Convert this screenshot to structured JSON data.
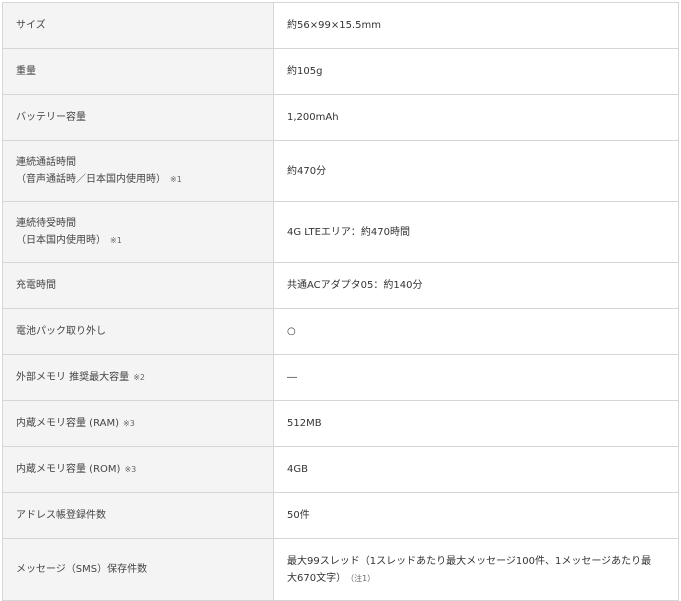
{
  "rows": [
    {
      "label": "サイズ",
      "value": "約56×99×15.5mm"
    },
    {
      "label": "重量",
      "value": "約105g"
    },
    {
      "label": "バッテリー容量",
      "value": "1,200mAh"
    },
    {
      "label": "連続通話時間",
      "label_sub": "（音声通話時／日本国内使用時）",
      "note": "※1",
      "value": "約470分"
    },
    {
      "label": "連続待受時間",
      "label_sub": "（日本国内使用時）",
      "note": "※1",
      "value": "4G LTEエリア：約470時間"
    },
    {
      "label": "充電時間",
      "value": "共通ACアダプタ05：約140分"
    },
    {
      "label": "電池パック取り外し",
      "value": "○"
    },
    {
      "label": "外部メモリ 推奨最大容量",
      "note": "※2",
      "value": "―"
    },
    {
      "label": "内蔵メモリ容量 (RAM)",
      "note": "※3",
      "value": "512MB"
    },
    {
      "label": "内蔵メモリ容量 (ROM)",
      "note": "※3",
      "value": "4GB"
    },
    {
      "label": "アドレス帳登録件数",
      "value": "50件"
    },
    {
      "label": "メッセージ（SMS）保存件数",
      "value_line1": "最大99スレッド（1スレッドあたり最大メッセージ100件、1メッセージあたり最",
      "value_line2": "大670文字）",
      "value_note": "（注1）"
    }
  ]
}
